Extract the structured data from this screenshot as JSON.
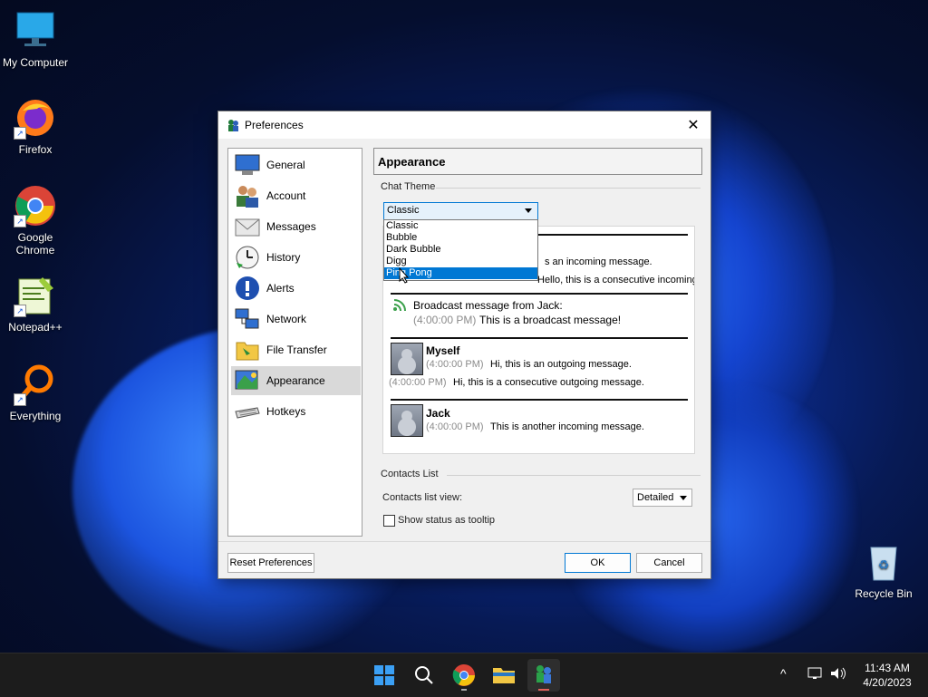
{
  "desktop": {
    "icons": [
      {
        "label": "My Computer",
        "icon": "monitor-icon"
      },
      {
        "label": "Firefox",
        "icon": "firefox-icon"
      },
      {
        "label": "Google Chrome",
        "icon": "chrome-icon"
      },
      {
        "label": "Notepad++",
        "icon": "notepadpp-icon"
      },
      {
        "label": "Everything",
        "icon": "everything-icon"
      },
      {
        "label": "Recycle Bin",
        "icon": "recycle-bin-icon"
      }
    ]
  },
  "window": {
    "title": "Preferences",
    "close_glyph": "✕",
    "nav": [
      {
        "label": "General",
        "icon": "monitor-icon"
      },
      {
        "label": "Account",
        "icon": "users-icon"
      },
      {
        "label": "Messages",
        "icon": "envelope-icon"
      },
      {
        "label": "History",
        "icon": "clock-icon"
      },
      {
        "label": "Alerts",
        "icon": "alert-icon"
      },
      {
        "label": "Network",
        "icon": "network-icon"
      },
      {
        "label": "File Transfer",
        "icon": "folder-icon"
      },
      {
        "label": "Appearance",
        "icon": "appearance-icon",
        "selected": true
      },
      {
        "label": "Hotkeys",
        "icon": "keyboard-icon"
      }
    ],
    "panel_title": "Appearance",
    "chat_theme": {
      "label": "Chat Theme",
      "selected": "Classic",
      "options": [
        "Classic",
        "Bubble",
        "Dark Bubble",
        "Digg",
        "Ping Pong"
      ],
      "highlighted": "Ping Pong"
    },
    "preview": {
      "incoming_tail_1": "s an incoming message.",
      "incoming_tail_2": "Hello, this is a consecutive incoming message.",
      "broadcast_header": "Broadcast message from Jack:",
      "broadcast_time": "(4:00:00 PM)",
      "broadcast_text": "This is a broadcast message!",
      "self_name": "Myself",
      "self_time": "(4:00:00 PM)",
      "self_text": "Hi, this is an outgoing message.",
      "self_time2": "(4:00:00 PM)",
      "self_text2": "Hi, this is a consecutive outgoing message.",
      "jack_name": "Jack",
      "jack_time": "(4:00:00 PM)",
      "jack_text": "This is another incoming message."
    },
    "contacts": {
      "label": "Contacts List",
      "view_label": "Contacts list view:",
      "view_value": "Detailed",
      "tooltip_label": "Show status as tooltip",
      "tooltip_checked": false
    },
    "buttons": {
      "reset": "Reset Preferences",
      "ok": "OK",
      "cancel": "Cancel"
    }
  },
  "taskbar": {
    "time": "11:43 AM",
    "date": "4/20/2023",
    "chevron": "^"
  }
}
